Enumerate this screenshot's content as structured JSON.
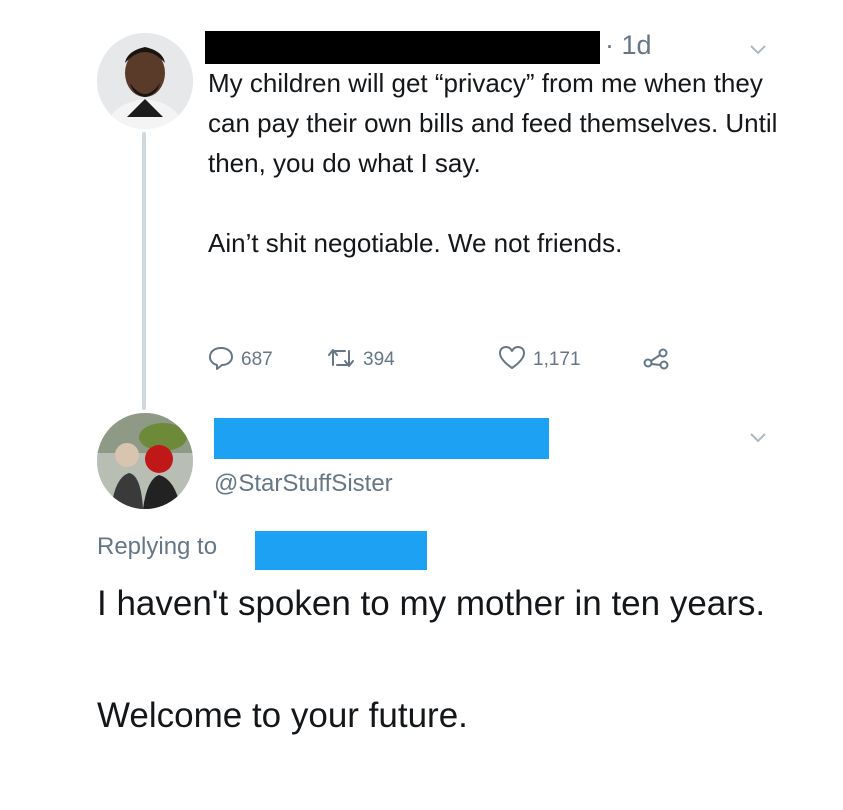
{
  "tweet1": {
    "timestamp": "· 1d",
    "text": "My children will get “privacy” from me when they can pay their own bills and feed themselves. Until then, you do what I say.\n\nAin’t shit negotiable. We not friends.",
    "actions": {
      "reply_count": "687",
      "retweet_count": "394",
      "like_count": "1,171"
    }
  },
  "tweet2": {
    "handle": "@StarStuffSister",
    "replying_label": "Replying to",
    "text": "I haven't spoken to my mother in ten years.\n\nWelcome to your future."
  },
  "colors": {
    "text": "#14171a",
    "muted": "#657786",
    "redaction_black": "#000000",
    "redaction_blue": "#1da1f2",
    "thread_line": "#cfd9de"
  }
}
